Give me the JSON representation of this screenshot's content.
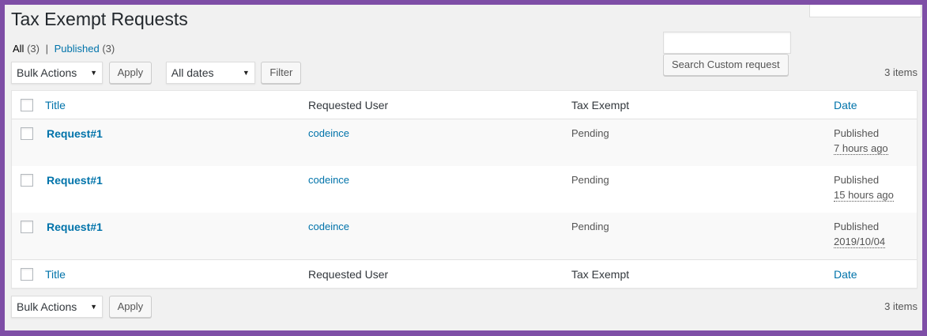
{
  "page": {
    "title": "Tax Exempt Requests"
  },
  "views": {
    "all_label": "All",
    "all_count": "(3)",
    "separator": "|",
    "published_label": "Published",
    "published_count": "(3)"
  },
  "search": {
    "value": "",
    "button_label": "Search Custom request"
  },
  "tablenav_top": {
    "bulk_actions": "Bulk Actions",
    "apply_label": "Apply",
    "dates_filter": "All dates",
    "filter_label": "Filter",
    "items_count": "3 items"
  },
  "tablenav_bottom": {
    "bulk_actions": "Bulk Actions",
    "apply_label": "Apply",
    "items_count": "3 items"
  },
  "table": {
    "columns": {
      "title": "Title",
      "requested_user": "Requested User",
      "tax_exempt": "Tax Exempt",
      "date": "Date"
    },
    "rows": [
      {
        "title": "Request#1",
        "user": "codeince",
        "tax_exempt": "Pending",
        "date_status": "Published",
        "date_value": "7 hours ago"
      },
      {
        "title": "Request#1",
        "user": "codeince",
        "tax_exempt": "Pending",
        "date_status": "Published",
        "date_value": "15 hours ago"
      },
      {
        "title": "Request#1",
        "user": "codeince",
        "tax_exempt": "Pending",
        "date_status": "Published",
        "date_value": "2019/10/04"
      }
    ]
  },
  "colors": {
    "frame_purple": "#7e4ea6",
    "link_blue": "#0073aa",
    "admin_bg": "#f1f1f1"
  },
  "icons": {
    "dropdown": "caret-down-icon",
    "checkbox": "checkbox"
  }
}
